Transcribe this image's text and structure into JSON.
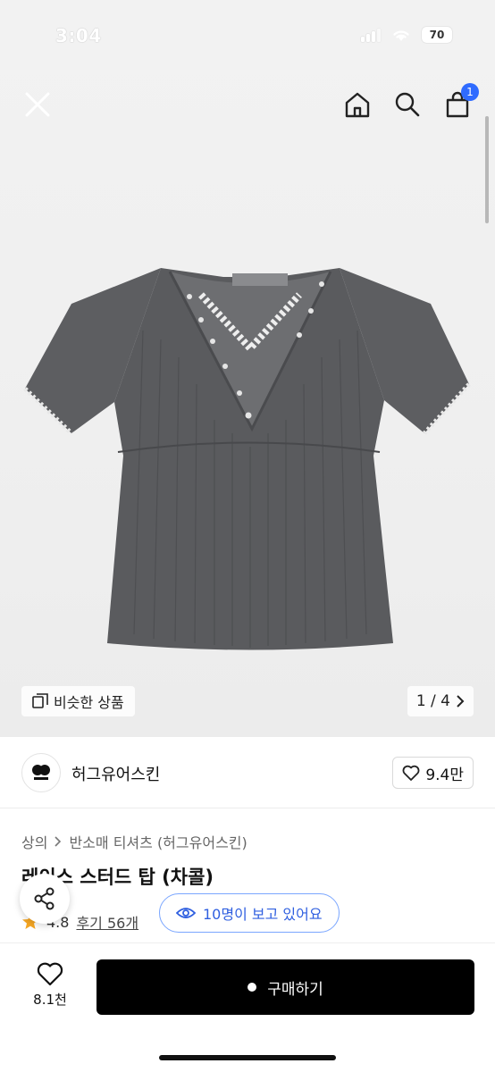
{
  "status_bar": {
    "time": "3:04",
    "battery": "70"
  },
  "nav": {
    "cart_count": "1"
  },
  "hero": {
    "similar_label": "비슷한 상품",
    "pager": "1 / 4"
  },
  "brand": {
    "name": "허그유어스킨",
    "likes": "9.4만"
  },
  "breadcrumb": {
    "category": "상의",
    "subcategory": "반소매 티셔츠 (허그유어스킨)"
  },
  "product": {
    "title": "레이스 스터드 탑 (차콜)",
    "rating": "4.8",
    "reviews": "후기 56개"
  },
  "viewers": "10명이 보고 있어요",
  "bottom": {
    "wish_count": "8.1천",
    "buy_label": "구매하기"
  },
  "colors": {
    "accent": "#2f6bff",
    "buy_bg": "#000000",
    "garment": "#5a5b5e"
  },
  "icons": [
    "close-icon",
    "home-icon",
    "search-icon",
    "bag-icon",
    "copy-icon",
    "chevron-right-icon",
    "heart-icon",
    "star-icon",
    "eye-icon",
    "share-icon"
  ]
}
